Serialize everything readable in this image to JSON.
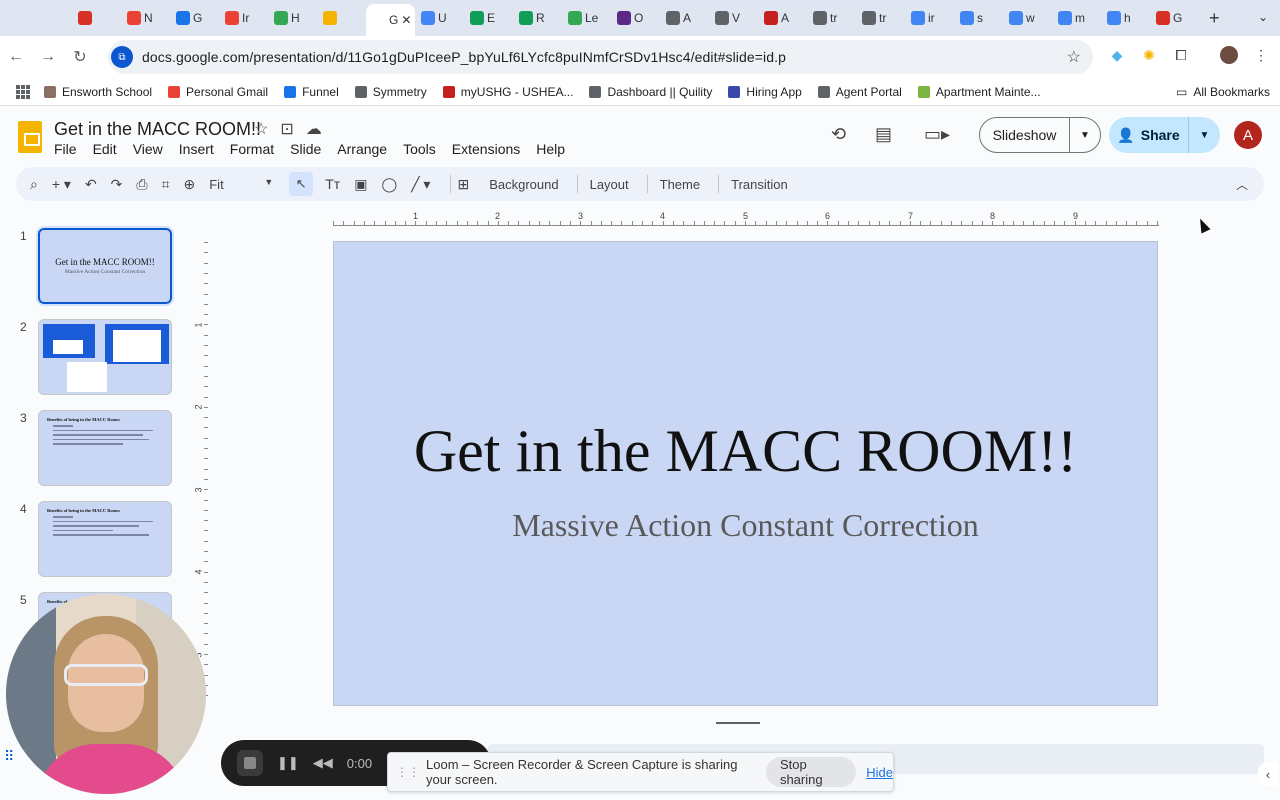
{
  "browser": {
    "tabs": [
      {
        "label": "",
        "icon": "record-icon",
        "color": "#d93025"
      },
      {
        "label": "N",
        "icon": "gmail-icon",
        "color": "#ea4335"
      },
      {
        "label": "G",
        "icon": "calendar-icon",
        "color": "#1a73e8"
      },
      {
        "label": "Ir",
        "icon": "gmail-icon",
        "color": "#ea4335"
      },
      {
        "label": "H",
        "icon": "drive-icon",
        "color": "#34a853"
      },
      {
        "label": "",
        "icon": "slides-icon",
        "color": "#f4b400"
      },
      {
        "label": "G",
        "icon": "",
        "color": "#ffffff",
        "active": true
      },
      {
        "label": "U",
        "icon": "docs-icon",
        "color": "#4285f4"
      },
      {
        "label": "E",
        "icon": "sheets-icon",
        "color": "#0f9d58"
      },
      {
        "label": "R",
        "icon": "sheets-icon",
        "color": "#0f9d58"
      },
      {
        "label": "Le",
        "icon": "app-icon",
        "color": "#34a853"
      },
      {
        "label": "O",
        "icon": "app-icon",
        "color": "#5b2a86"
      },
      {
        "label": "A",
        "icon": "globe-icon",
        "color": "#5f6368"
      },
      {
        "label": "V",
        "icon": "globe-icon",
        "color": "#5f6368"
      },
      {
        "label": "A",
        "icon": "app-icon",
        "color": "#c5221f"
      },
      {
        "label": "tr",
        "icon": "globe-icon",
        "color": "#5f6368"
      },
      {
        "label": "tr",
        "icon": "globe-icon",
        "color": "#5f6368"
      },
      {
        "label": "ir",
        "icon": "google-icon",
        "color": "#4285f4"
      },
      {
        "label": "s",
        "icon": "google-icon",
        "color": "#4285f4"
      },
      {
        "label": "w",
        "icon": "google-icon",
        "color": "#4285f4"
      },
      {
        "label": "m",
        "icon": "google-icon",
        "color": "#4285f4"
      },
      {
        "label": "h",
        "icon": "google-icon",
        "color": "#4285f4"
      },
      {
        "label": "G",
        "icon": "app-icon",
        "color": "#d93025"
      }
    ],
    "active_tab_close": "✕",
    "new_tab": "+",
    "url": "docs.google.com/presentation/d/11Go1gDuPIceeP_bpYuLf6LYcfc8puINmfCrSDv1Hsc4/edit#slide=id.p",
    "bookmarks": [
      {
        "label": "Ensworth School",
        "color": "#8d6e63"
      },
      {
        "label": "Personal Gmail",
        "color": "#ea4335"
      },
      {
        "label": "Funnel",
        "color": "#1a73e8"
      },
      {
        "label": "Symmetry",
        "color": "#5f6368"
      },
      {
        "label": "myUSHG - USHEA...",
        "color": "#c5221f"
      },
      {
        "label": "Dashboard || Quility",
        "color": "#5f6368"
      },
      {
        "label": "Hiring App",
        "color": "#3949ab"
      },
      {
        "label": "Agent Portal",
        "color": "#5f6368"
      },
      {
        "label": "Apartment Mainte...",
        "color": "#7cb342"
      }
    ],
    "all_bookmarks": "All Bookmarks"
  },
  "docs": {
    "title": "Get in the MACC ROOM!!",
    "menu": [
      "File",
      "Edit",
      "View",
      "Insert",
      "Format",
      "Slide",
      "Arrange",
      "Tools",
      "Extensions",
      "Help"
    ],
    "slideshow_label": "Slideshow",
    "share_label": "Share",
    "avatar_letter": "A",
    "toolbar": {
      "zoom": "Fit",
      "background": "Background",
      "layout": "Layout",
      "theme": "Theme",
      "transition": "Transition"
    }
  },
  "ruler": {
    "h": [
      "1",
      "2",
      "3",
      "4",
      "5",
      "6",
      "7",
      "8",
      "9"
    ],
    "v": [
      "1",
      "2",
      "3",
      "4",
      "5"
    ]
  },
  "slides": [
    {
      "num": "1",
      "title": "Get in the MACC ROOM!!",
      "subtitle": "Massive Action Constant Correction"
    },
    {
      "num": "2"
    },
    {
      "num": "3",
      "heading": "Benefits of being in the MACC Room:"
    },
    {
      "num": "4",
      "heading": "Benefits of being in the MACC Room:"
    },
    {
      "num": "5",
      "heading": "Benefits of"
    }
  ],
  "current_slide": {
    "title": "Get in the MACC ROOM!!",
    "subtitle": "Massive Action Constant Correction"
  },
  "loom": {
    "timer": "0:00",
    "message": "Loom – Screen Recorder & Screen Capture is sharing your screen.",
    "stop_sharing": "Stop sharing",
    "hide": "Hide"
  }
}
